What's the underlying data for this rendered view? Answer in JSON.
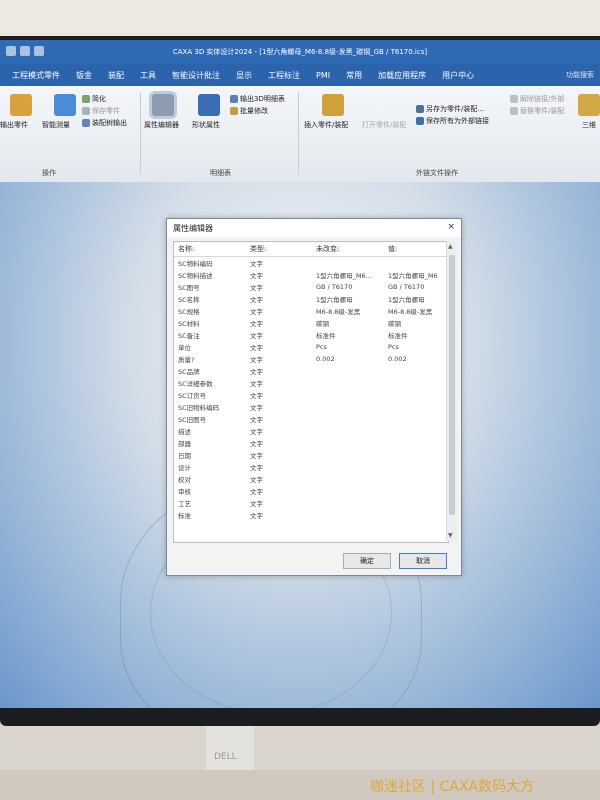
{
  "window": {
    "title": "CAXA 3D 实体设计2024 - [1型六角螺母_M6-8.8级-发黑_碳钢_GB / T6170.ics]"
  },
  "menu": {
    "items": [
      "工程模式零件",
      "钣金",
      "装配",
      "工具",
      "智能设计批注",
      "显示",
      "工程标注",
      "PMI",
      "常用",
      "加载应用程序",
      "用户中心"
    ],
    "search": "功能搜索"
  },
  "ribbon": {
    "btn_export_part": "输出零件",
    "btn_smart_measure": "智能测量",
    "btn_simplify": "简化",
    "btn_save_part": "保存零件",
    "btn_assembly_output": "装配树输出",
    "btn_attr_editor": "属性编辑器",
    "btn_form_attr": "形状属性",
    "btn_output_3d_table": "输出3D明细表",
    "btn_batch_modify": "批量修改",
    "btn_insert_part": "插入零件/装配",
    "btn_open_part_assembly": "打开零件/装配",
    "btn_save_as_part": "另存为零件/装配...",
    "btn_save_all_external": "保存所有为外部链接",
    "btn_unlink_external": "解除链接/外部",
    "btn_replace_part": "替换零件/装配",
    "btn_three_view": "三维",
    "group_operate": "操作",
    "group_table": "明细表",
    "group_external": "外链文件操作"
  },
  "dialog": {
    "title": "属性编辑器",
    "close": "×",
    "headers": [
      "名称:",
      "类型:",
      "未改变:",
      "值:"
    ],
    "rows": [
      [
        "SC物料编码",
        "文字",
        "",
        ""
      ],
      [
        "SC物料描述",
        "文字",
        "1型六角螺母_M6...",
        "1型六角螺母_M6"
      ],
      [
        "SC图号",
        "文字",
        "GB / T6170",
        "GB / T6170"
      ],
      [
        "SC名称",
        "文字",
        "1型六角螺母",
        "1型六角螺母"
      ],
      [
        "SC规格",
        "文字",
        "M6-8.8级-发黑",
        "M6-8.8级-发黑"
      ],
      [
        "SC材料",
        "文字",
        "碳钢",
        "碳钢"
      ],
      [
        "SC备注",
        "文字",
        "标准件",
        "标准件"
      ],
      [
        "单位",
        "文字",
        "Pcs",
        "Pcs"
      ],
      [
        "质量?",
        "文字",
        "0.002",
        "0.002"
      ],
      [
        "SC品牌",
        "文字",
        "",
        ""
      ],
      [
        "SC详细参数",
        "文字",
        "",
        ""
      ],
      [
        "SC订货号",
        "文字",
        "",
        ""
      ],
      [
        "SC旧物料编码",
        "文字",
        "",
        ""
      ],
      [
        "SC旧图号",
        "文字",
        "",
        ""
      ],
      [
        "描述",
        "文字",
        "",
        ""
      ],
      [
        "部器",
        "文字",
        "",
        ""
      ],
      [
        "日期",
        "文字",
        "",
        ""
      ],
      [
        "设计",
        "文字",
        "",
        ""
      ],
      [
        "校对",
        "文字",
        "",
        ""
      ],
      [
        "审核",
        "文字",
        "",
        ""
      ],
      [
        "工艺",
        "文字",
        "",
        ""
      ],
      [
        "标准",
        "文字",
        "",
        ""
      ]
    ],
    "ok": "确定",
    "cancel": "取消"
  },
  "watermark": "咖迷社区 | CAXA数码大方",
  "stand_logo": "DELL"
}
